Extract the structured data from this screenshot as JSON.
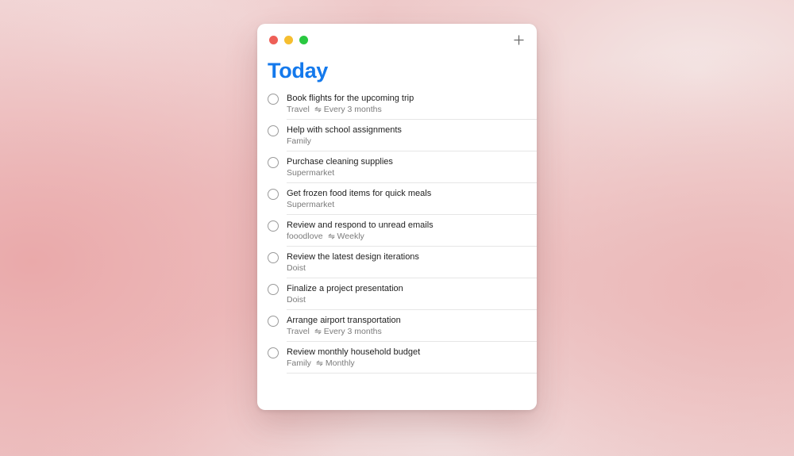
{
  "window": {
    "title": "Today",
    "accent_color": "#1479ec",
    "add_icon": "plus-icon"
  },
  "tasks": [
    {
      "name": "Book flights for the upcoming trip",
      "project": "Travel",
      "recurrence": "Every 3 months"
    },
    {
      "name": "Help with school assignments",
      "project": "Family",
      "recurrence": ""
    },
    {
      "name": "Purchase cleaning supplies",
      "project": "Supermarket",
      "recurrence": ""
    },
    {
      "name": "Get frozen food items for quick meals",
      "project": "Supermarket",
      "recurrence": ""
    },
    {
      "name": "Review and respond to unread emails",
      "project": "fooodlove",
      "recurrence": "Weekly"
    },
    {
      "name": "Review the latest design iterations",
      "project": "Doist",
      "recurrence": ""
    },
    {
      "name": "Finalize a project presentation",
      "project": "Doist",
      "recurrence": ""
    },
    {
      "name": "Arrange airport transportation",
      "project": "Travel",
      "recurrence": "Every 3 months"
    },
    {
      "name": "Review monthly household budget",
      "project": "Family",
      "recurrence": "Monthly"
    }
  ]
}
